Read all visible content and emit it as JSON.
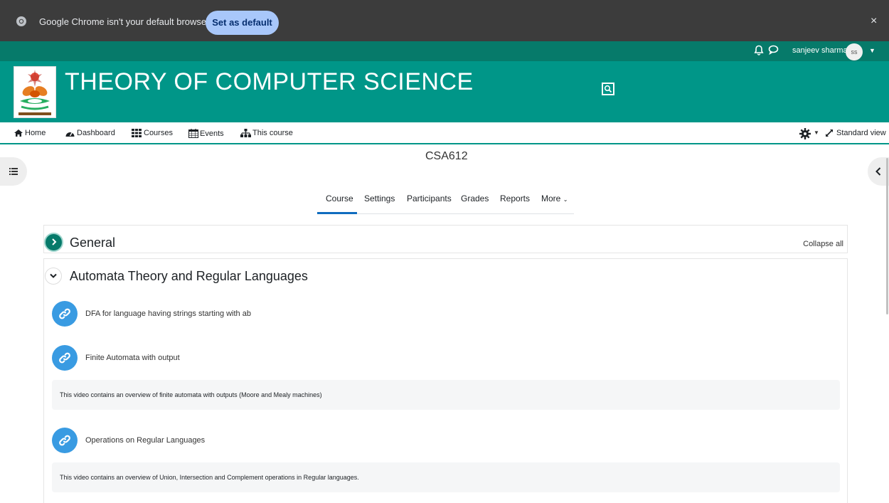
{
  "chrome": {
    "message": "Google Chrome isn't your default browser",
    "set_default_label": "Set as default",
    "close": "×"
  },
  "topnav": {
    "user_name": "sanjeev sharma",
    "avatar_initials": "ss"
  },
  "banner": {
    "title": "THEORY OF COMPUTER SCIENCE"
  },
  "secnav": {
    "items": [
      "Home",
      "Dashboard",
      "Courses",
      "Events",
      "This course"
    ],
    "standard_view": "Standard view"
  },
  "course": {
    "code": "CSA612",
    "tabs": [
      "Course",
      "Settings",
      "Participants",
      "Grades",
      "Reports",
      "More"
    ]
  },
  "sections": {
    "general": {
      "title": "General",
      "collapse_all": "Collapse all"
    },
    "automata": {
      "title": "Automata Theory and Regular Languages",
      "activities": [
        {
          "label": "DFA for language having strings starting with ab",
          "description": ""
        },
        {
          "label": "Finite Automata with output",
          "description": "This video contains an overview of finite automata with outputs (Moore and Mealy machines)"
        },
        {
          "label": "Operations on Regular Languages",
          "description": "This video contains an overview of Union, Intersection and Complement operations in Regular languages."
        }
      ]
    }
  },
  "colors": {
    "chrome_bar": "#3c3c3c",
    "teal": "#009688",
    "teal_dark": "#067a6a",
    "activity_blue": "#399be2",
    "tab_underline": "#0f6cbf"
  }
}
